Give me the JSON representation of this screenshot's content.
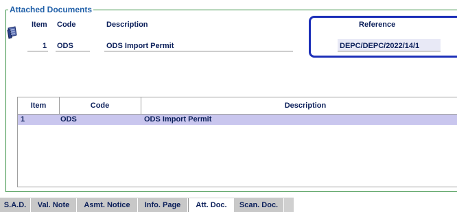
{
  "section": {
    "legend": "Attached Documents"
  },
  "form": {
    "headers": {
      "item": "Item",
      "code": "Code",
      "description": "Description",
      "reference": "Reference"
    },
    "values": {
      "item": "1",
      "code": "ODS",
      "description": "ODS Import Permit",
      "reference": "DEPC/DEPC/2022/14/1"
    }
  },
  "grid": {
    "columns": [
      "Item",
      "Code",
      "Description"
    ],
    "rows": [
      {
        "item": "1",
        "code": "ODS",
        "description": "ODS Import Permit"
      }
    ]
  },
  "tabs": [
    {
      "label": "S.A.D.",
      "active": false
    },
    {
      "label": "Val. Note",
      "active": false
    },
    {
      "label": "Asmt. Notice",
      "active": false
    },
    {
      "label": "Info. Page",
      "active": false
    },
    {
      "label": "Att. Doc.",
      "active": true
    },
    {
      "label": "Scan. Doc.",
      "active": false
    }
  ],
  "icons": {
    "document": "document-scroll-icon"
  },
  "colors": {
    "highlight_box": "#1c2fb8",
    "selected_row": "#c9c6ee",
    "fieldset_border": "#2e8b3a"
  }
}
